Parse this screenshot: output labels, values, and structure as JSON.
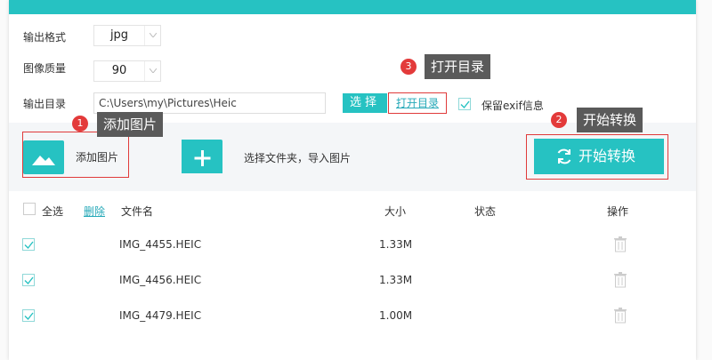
{
  "settings": {
    "format_label": "输出格式",
    "format_value": "jpg",
    "quality_label": "图像质量",
    "quality_value": "90",
    "dir_label": "输出目录",
    "dir_value": "C:\\Users\\my\\Pictures\\Heic",
    "choose_label": "选择",
    "open_dir_label": "打开目录",
    "keep_exif_label": "保留exif信息"
  },
  "toolbar": {
    "add_image_label": "添加图片",
    "add_folder_label": "选择文件夹，导入图片",
    "start_label": "开始转换"
  },
  "annotations": [
    {
      "number": "1",
      "text": "添加图片"
    },
    {
      "number": "2",
      "text": "开始转换"
    },
    {
      "number": "3",
      "text": "打开目录"
    }
  ],
  "table": {
    "select_all": "全选",
    "delete": "删除",
    "col_name": "文件名",
    "col_size": "大小",
    "col_status": "状态",
    "col_action": "操作",
    "rows": [
      {
        "name": "IMG_4455.HEIC",
        "size": "1.33M",
        "status": ""
      },
      {
        "name": "IMG_4456.HEIC",
        "size": "1.33M",
        "status": ""
      },
      {
        "name": "IMG_4479.HEIC",
        "size": "1.00M",
        "status": ""
      }
    ]
  },
  "colors": {
    "accent": "#26c2c2",
    "highlight": "#e03a3a",
    "tooltip": "#5a5a5a"
  }
}
